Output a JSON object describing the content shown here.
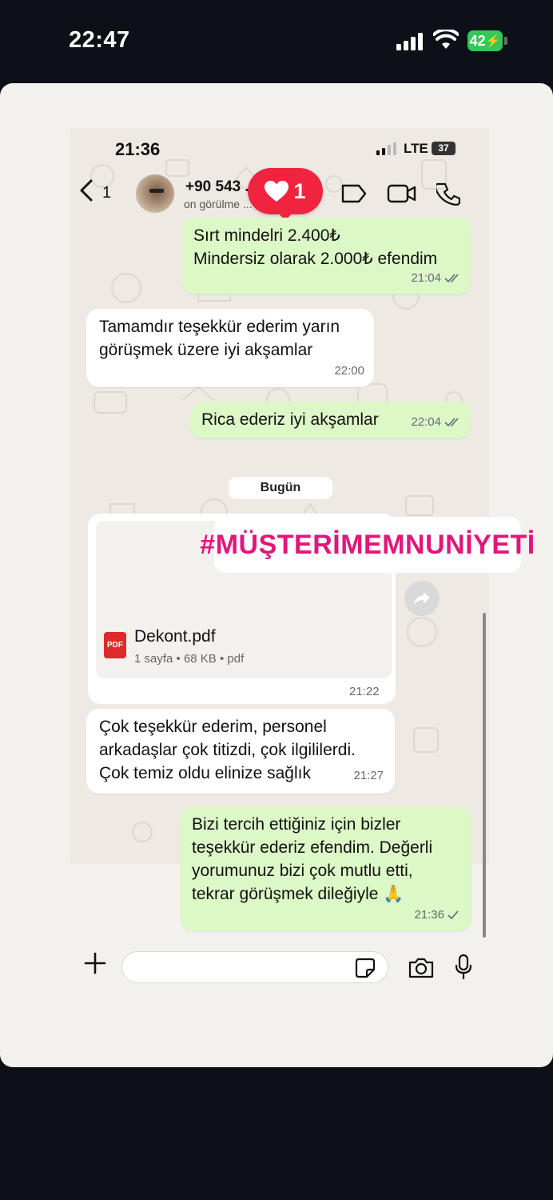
{
  "outer_status": {
    "time": "22:47",
    "battery": "42"
  },
  "inner_status": {
    "time": "21:36",
    "network": "LTE",
    "battery": "37"
  },
  "header": {
    "back_count": "1",
    "contact_name": "+90 543 ... 2",
    "contact_sub": "on görülme ... 7",
    "like_count": "1"
  },
  "messages": [
    {
      "dir": "out",
      "text": "Sırt mindelri 2.400₺\nMindersiz olarak 2.000₺ efendim",
      "time": "21:04",
      "ticks": "double"
    },
    {
      "dir": "in",
      "text": "Tamamdır teşekkür ederim yarın\ngörüşmek üzere iyi akşamlar",
      "time": "22:00"
    },
    {
      "dir": "out",
      "text": "Rica ederiz iyi akşamlar",
      "time": "22:04",
      "ticks": "double"
    }
  ],
  "date_divider": "Bugün",
  "hashtag": "#MÜŞTERİMEMNUNİYETİ",
  "document": {
    "name": "Dekont.pdf",
    "info": "1 sayfa • 68 KB • pdf",
    "icon_label": "PDF",
    "time": "21:22"
  },
  "messages_after": [
    {
      "dir": "in",
      "text": "Çok teşekkür ederim, personel\narkadaşlar çok titizdi, çok ilgililerdi.\nÇok temiz oldu elinize sağlık",
      "time": "21:27"
    },
    {
      "dir": "out",
      "text": "Bizi tercih ettiğiniz için bizler\nteşekkür ederiz efendim. Değerli\nyorumunuz bizi çok mutlu etti,\ntekrar görüşmek dileğiyle 🙏",
      "time": "21:36",
      "ticks": "single"
    }
  ],
  "input": {
    "placeholder": ""
  },
  "colors": {
    "outgoing": "#dcf8c6",
    "incoming": "#ffffff",
    "hashtag": "#e4157a",
    "like": "#f0243f",
    "battery": "#34c759"
  }
}
